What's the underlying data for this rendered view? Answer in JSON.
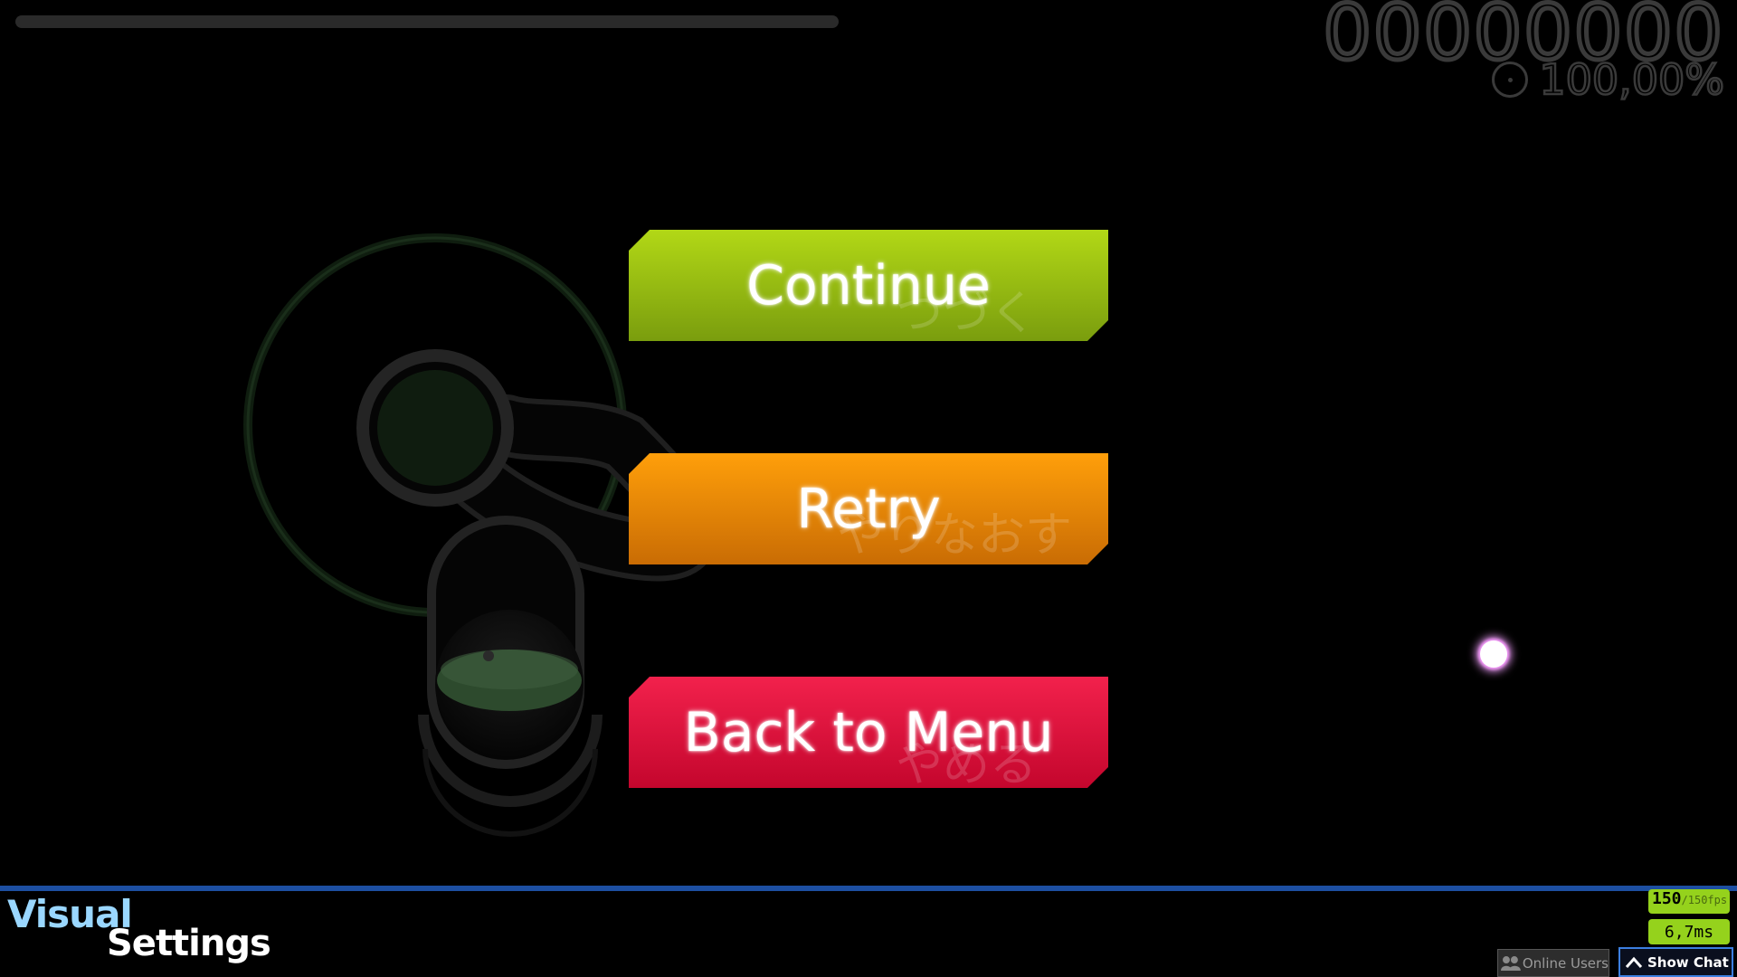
{
  "hud": {
    "progress_fraction": 0.0,
    "score": "00000000",
    "accuracy": "100,00%"
  },
  "pause_menu": {
    "continue_label": "Continue",
    "continue_jp": "つづく",
    "retry_label": "Retry",
    "retry_jp": "やりなおす",
    "back_label": "Back to Menu",
    "back_jp": "やめる"
  },
  "bottom_bar": {
    "visual_label": "Visual",
    "settings_label": "Settings",
    "fps_current": "150",
    "fps_limit": "/150fps",
    "frame_time": "6,7ms",
    "online_users_label": "Online Users",
    "show_chat_label": "Show Chat"
  },
  "colors": {
    "continue": "#9ec512",
    "retry": "#f08a06",
    "back": "#e0123e",
    "bottom_line": "#1d4fa1",
    "fps_badge": "#95d21c",
    "cursor_glow": "#f3a2ff"
  },
  "icons": {
    "accuracy": "accuracy-pie-icon",
    "online_users": "users-icon",
    "show_chat": "chevron-up-icon"
  }
}
